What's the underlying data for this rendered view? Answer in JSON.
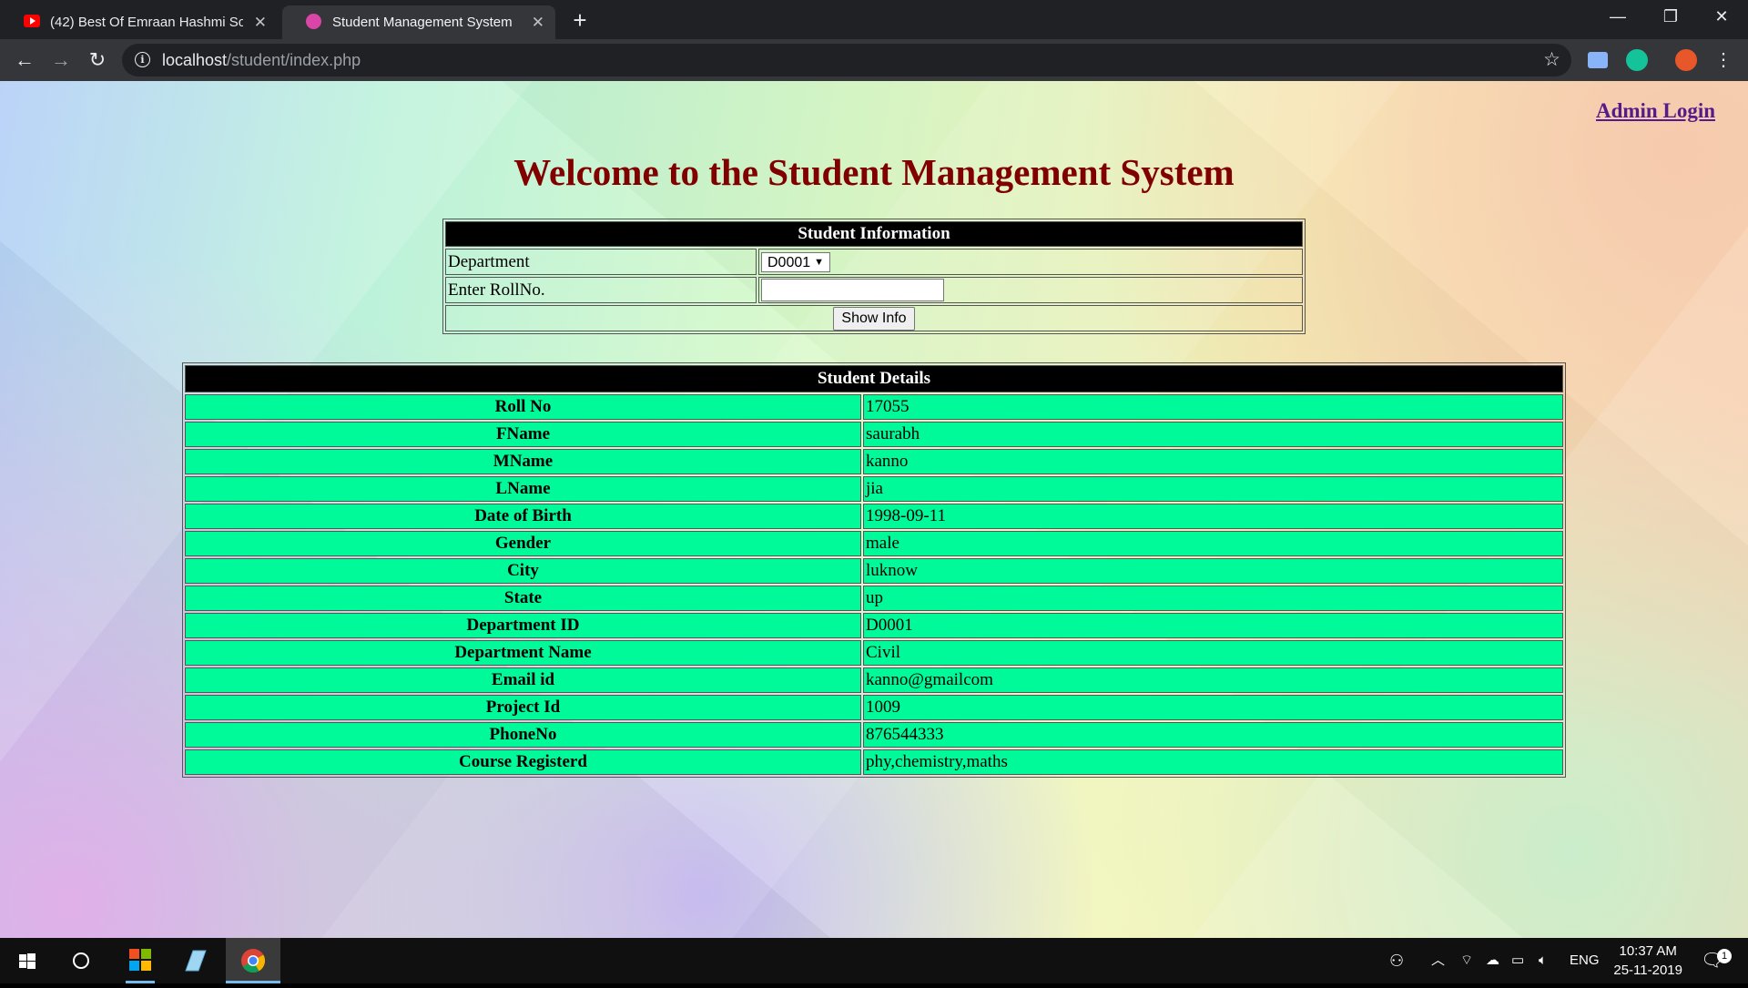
{
  "browser": {
    "tabs": [
      {
        "title": "(42) Best Of Emraan Hashmi Songs",
        "active": false
      },
      {
        "title": "Student Management System",
        "active": true
      }
    ],
    "url_host": "localhost",
    "url_path": "/student/index.php"
  },
  "page": {
    "admin_link": "Admin Login",
    "heading": "Welcome to the Student Management System",
    "info_form": {
      "header": "Student Information",
      "department_label": "Department",
      "department_value": "D0001",
      "rollno_label": "Enter RollNo.",
      "rollno_value": "",
      "button_label": "Show Info"
    },
    "details": {
      "header": "Student Details",
      "rows": [
        {
          "label": "Roll No",
          "value": "17055"
        },
        {
          "label": "FName",
          "value": "saurabh"
        },
        {
          "label": "MName",
          "value": "kanno"
        },
        {
          "label": "LName",
          "value": "jia"
        },
        {
          "label": "Date of Birth",
          "value": "1998-09-11"
        },
        {
          "label": "Gender",
          "value": "male"
        },
        {
          "label": "City",
          "value": "luknow"
        },
        {
          "label": "State",
          "value": "up"
        },
        {
          "label": "Department ID",
          "value": "D0001"
        },
        {
          "label": "Department Name",
          "value": "Civil"
        },
        {
          "label": "Email id",
          "value": "kanno@gmailcom"
        },
        {
          "label": "Project Id",
          "value": "1009"
        },
        {
          "label": "PhoneNo",
          "value": "876544333"
        },
        {
          "label": "Course Registerd",
          "value": "phy,chemistry,maths"
        }
      ]
    }
  },
  "taskbar": {
    "language": "ENG",
    "time": "10:37 AM",
    "date": "25-11-2019",
    "notification_count": "1"
  },
  "colors": {
    "heading": "#800000",
    "details_row_bg": "#00fa9a",
    "link": "#551a8b"
  }
}
